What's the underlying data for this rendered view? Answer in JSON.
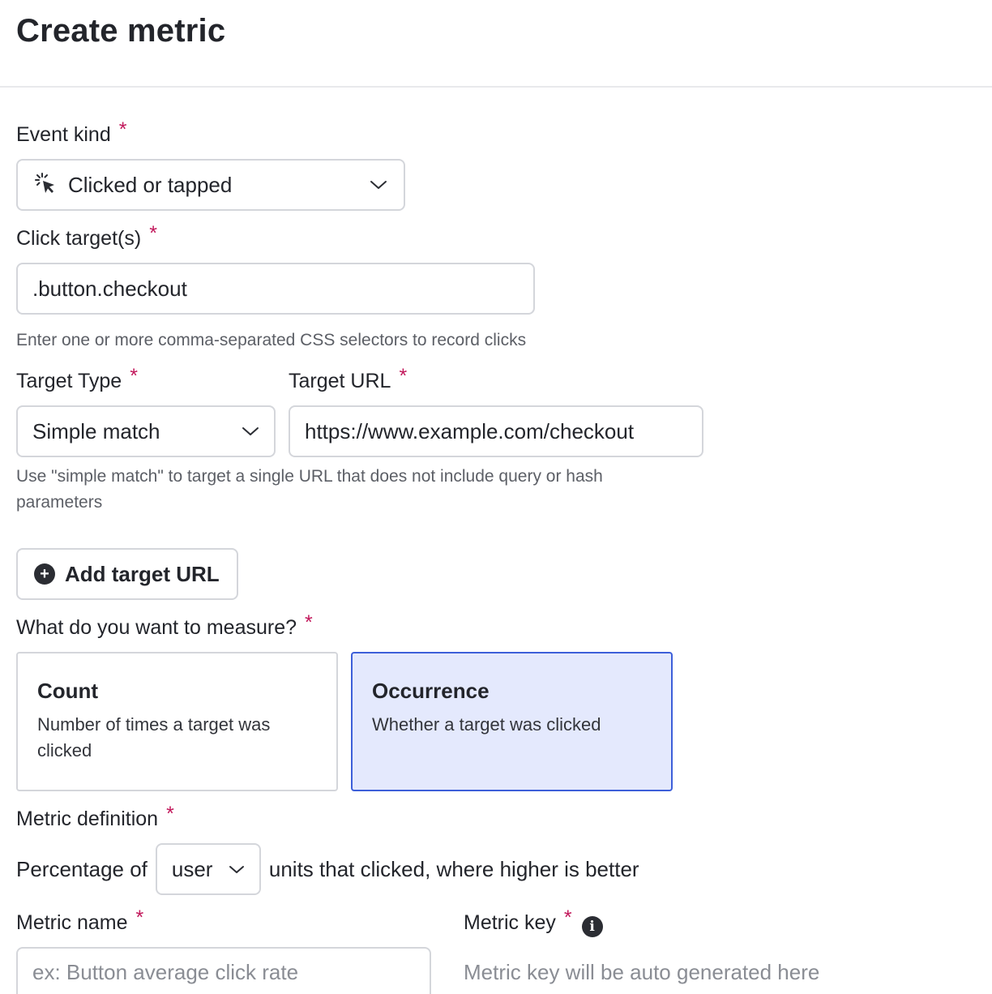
{
  "header": {
    "title": "Create metric"
  },
  "required_marker": "*",
  "event_kind": {
    "label": "Event kind",
    "selected": "Clicked or tapped",
    "icon": "cursor-click-icon"
  },
  "click_targets": {
    "label": "Click target(s)",
    "value": ".button.checkout",
    "help": "Enter one or more comma-separated CSS selectors to record clicks"
  },
  "target_type": {
    "label": "Target Type",
    "selected": "Simple match"
  },
  "target_url": {
    "label": "Target URL",
    "value": "https://www.example.com/checkout",
    "help": "Use \"simple match\" to target a single URL that does not include query or hash parameters"
  },
  "add_target_url": {
    "label": "Add target URL",
    "icon": "plus-circle-icon"
  },
  "measure": {
    "label": "What do you want to measure?",
    "options": [
      {
        "title": "Count",
        "description": "Number of times a target was clicked",
        "selected": false
      },
      {
        "title": "Occurrence",
        "description": "Whether a target was clicked",
        "selected": true
      }
    ]
  },
  "metric_definition": {
    "label": "Metric definition",
    "prefix": "Percentage of",
    "unit": "user",
    "suffix": "units that clicked, where higher is better"
  },
  "metric_name": {
    "label": "Metric name",
    "placeholder": "ex: Button average click rate",
    "value": ""
  },
  "metric_key": {
    "label": "Metric key",
    "placeholder": "Metric key will be auto generated here",
    "icon": "info-icon"
  },
  "colors": {
    "required": "#c2185b",
    "selected_card_border": "#3d5fd9",
    "selected_card_bg": "#e4e9fd"
  }
}
